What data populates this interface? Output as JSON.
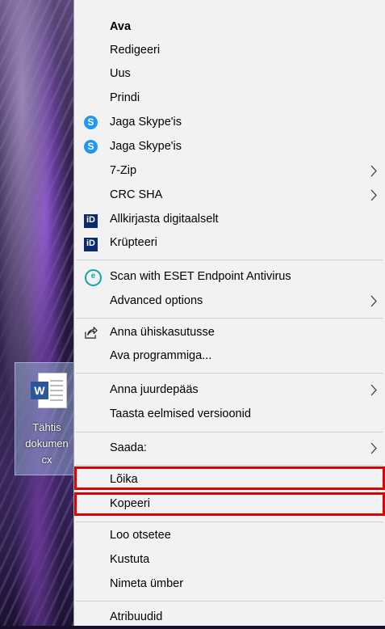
{
  "desktop": {
    "icon_label_lines": [
      "Tähtis",
      "dokumen",
      "cx"
    ],
    "icon_badge": "W"
  },
  "menu": {
    "items": [
      {
        "label": "Ava"
      },
      {
        "label": "Redigeeri"
      },
      {
        "label": "Uus"
      },
      {
        "label": "Prindi"
      },
      {
        "label": "Jaga Skype'is",
        "icon": "skype-icon"
      },
      {
        "label": "Jaga Skype'is",
        "icon": "skype-icon"
      },
      {
        "label": "7-Zip",
        "submenu": true
      },
      {
        "label": "CRC SHA",
        "submenu": true
      },
      {
        "label": "Allkirjasta digitaalselt",
        "icon": "id-card-icon"
      },
      {
        "label": "Krüpteeri",
        "icon": "id-card-icon"
      },
      {
        "label": "Scan with ESET Endpoint Antivirus",
        "icon": "eset-icon"
      },
      {
        "label": "Advanced options",
        "submenu": true
      },
      {
        "label": "Anna ühiskasutusse",
        "icon": "share-icon"
      },
      {
        "label": "Ava programmiga..."
      },
      {
        "label": "Anna juurdepääs",
        "submenu": true
      },
      {
        "label": "Taasta eelmised versioonid"
      },
      {
        "label": "Saada:",
        "submenu": true
      },
      {
        "label": "Lõika",
        "highlighted": true
      },
      {
        "label": "Kopeeri",
        "highlighted": true
      },
      {
        "label": "Loo otsetee"
      },
      {
        "label": "Kustuta"
      },
      {
        "label": "Nimeta ümber"
      },
      {
        "label": "Atribuudid"
      }
    ],
    "highlight_color": "#e00000",
    "skype_color": "#2196f3",
    "id_color": "#0c2a6e",
    "eset_color": "#10a5a5"
  }
}
